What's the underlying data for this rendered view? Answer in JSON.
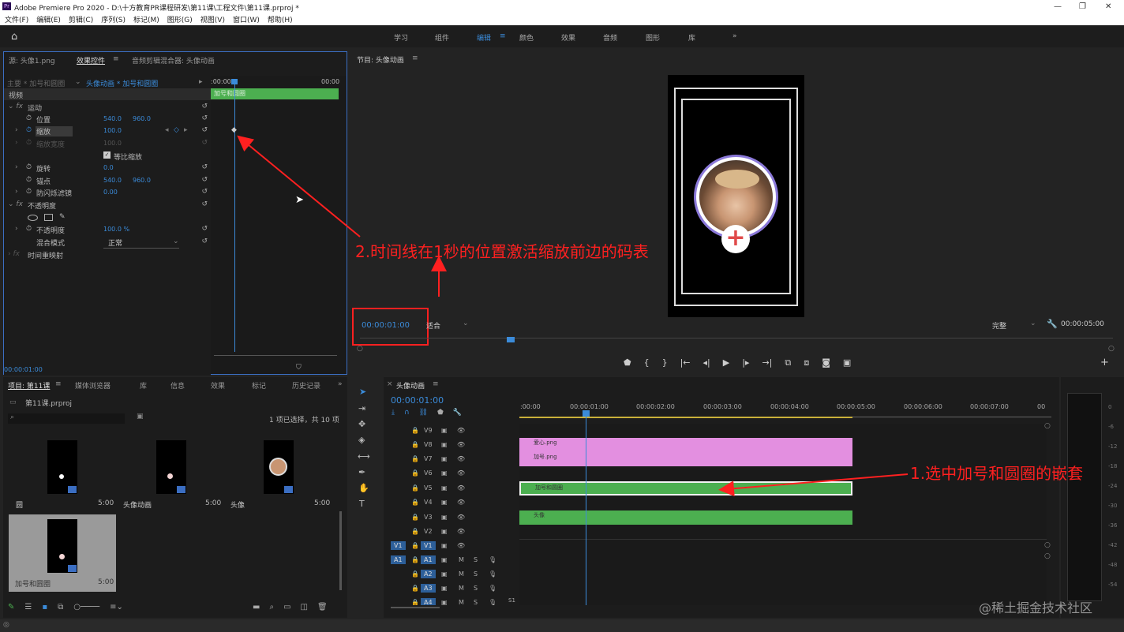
{
  "titlebar": {
    "app_icon": "Pr",
    "title": "Adobe Premiere Pro 2020 - D:\\十方教育PR课程研发\\第11课\\工程文件\\第11课.prproj *",
    "menus": [
      "文件(F)",
      "编辑(E)",
      "剪辑(C)",
      "序列(S)",
      "标记(M)",
      "图形(G)",
      "视图(V)",
      "窗口(W)",
      "帮助(H)"
    ]
  },
  "workspaces": {
    "items": [
      "学习",
      "组件",
      "编辑",
      "颜色",
      "效果",
      "音频",
      "图形",
      "库"
    ],
    "active": "编辑",
    "more": "»"
  },
  "effect_panel": {
    "tabs": [
      "源: 头像1.png",
      "效果控件",
      "音频剪辑混合器: 头像动画"
    ],
    "active_tab": "效果控件",
    "master_label": "主要 * 加号和圆圈",
    "clip_label": "头像动画 * 加号和圆圈",
    "ruler_start": ":00:00",
    "ruler_end": "00:00",
    "clip_bar": "加号和圆圈",
    "section_video": "视频",
    "motion": "运动",
    "position": {
      "label": "位置",
      "x": "540.0",
      "y": "960.0"
    },
    "scale": {
      "label": "缩放",
      "value": "100.0"
    },
    "scale_width": {
      "label": "缩放宽度",
      "value": "100.0"
    },
    "uniform_scale": "等比缩放",
    "rotation": {
      "label": "旋转",
      "value": "0.0"
    },
    "anchor": {
      "label": "锚点",
      "x": "540.0",
      "y": "960.0"
    },
    "antiflicker": {
      "label": "防闪烁滤镜",
      "value": "0.00"
    },
    "opacity_section": "不透明度",
    "opacity": {
      "label": "不透明度",
      "value": "100.0 %"
    },
    "blend_mode": {
      "label": "混合模式",
      "value": "正常"
    },
    "time_remap": "时间重映射",
    "timecode": "00:00:01:00"
  },
  "program_monitor": {
    "title": "节目: 头像动画",
    "timecode": "00:00:01:00",
    "fit": "适合",
    "quality": "完整",
    "duration": "00:00:05:00"
  },
  "project_panel": {
    "tabs": [
      "项目: 第11课",
      "媒体浏览器",
      "库",
      "信息",
      "效果",
      "标记",
      "历史记录"
    ],
    "file": "第11课.prproj",
    "selection_info": "1 项已选择，共 10 项",
    "items": [
      {
        "name": "圆",
        "duration": "5:00"
      },
      {
        "name": "头像动画",
        "duration": "5:00"
      },
      {
        "name": "头像",
        "duration": "5:00"
      },
      {
        "name": "加号和圆圈",
        "duration": "5:00"
      }
    ]
  },
  "timeline": {
    "title": "头像动画",
    "timecode": "00:00:01:00",
    "ticks": [
      ":00:00",
      "00:00:01:00",
      "00:00:02:00",
      "00:00:03:00",
      "00:00:04:00",
      "00:00:05:00",
      "00:00:06:00",
      "00:00:07:00",
      "00"
    ],
    "video_tracks": [
      "V9",
      "V8",
      "V7",
      "V6",
      "V5",
      "V4",
      "V3",
      "V2",
      "V1"
    ],
    "audio_tracks": [
      "A1",
      "A2",
      "A3",
      "A4"
    ],
    "clips": [
      {
        "name": "爱心.png",
        "track": "V8",
        "color": "#e38fe0"
      },
      {
        "name": "加号.png",
        "track": "V7",
        "color": "#e38fe0"
      },
      {
        "name": "加号和圆圈",
        "track": "V5",
        "color": "#4caf50"
      },
      {
        "name": "头像",
        "track": "V3",
        "color": "#4caf50"
      }
    ],
    "mute": "M",
    "solo": "S",
    "bottom_label": "S1"
  },
  "annotations": {
    "step1": "1.选中加号和圆圈的嵌套",
    "step2": "2.时间线在1秒的位置激活缩放前边的码表"
  },
  "watermark": "@稀土掘金技术社区",
  "colors": {
    "accent": "#3b8bd9",
    "annotation": "#ff2020",
    "pink_clip": "#e38fe0",
    "green_clip": "#4caf50"
  }
}
